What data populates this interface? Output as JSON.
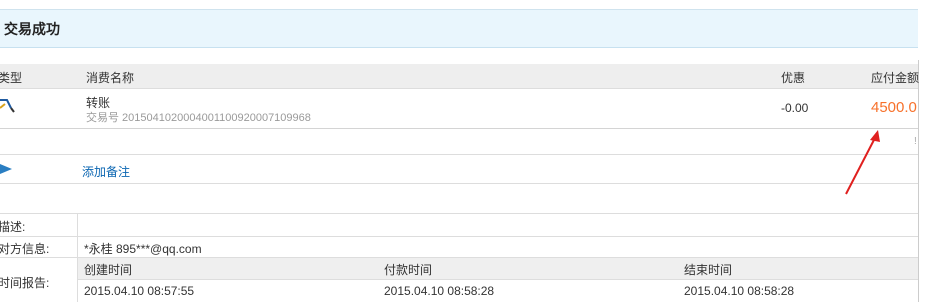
{
  "banner": {
    "title": "交易成功"
  },
  "table_header": {
    "type": "类型",
    "name": "消费名称",
    "discount": "优惠",
    "amount": "应付金额"
  },
  "item": {
    "icon": "transfer-icon",
    "name": "转账",
    "trade_no": "交易号 2015041020004001100920007109968",
    "discount": "-0.00",
    "amount": "4500.0"
  },
  "misc": {
    "tiny_mark": "!"
  },
  "note": {
    "icon": "note-icon",
    "add_label": "添加备注"
  },
  "details": {
    "desc_label": "描述:",
    "counterparty_label": "对方信息:",
    "counterparty_value": "*永桂 895***@qq.com",
    "time_label": "时间报告:"
  },
  "times": {
    "headers": [
      "创建时间",
      "付款时间",
      "结束时间"
    ],
    "values": [
      "2015.04.10 08:57:55",
      "2015.04.10 08:58:28",
      "2015.04.10 08:58:28"
    ]
  },
  "colors": {
    "amount": "#f7712b",
    "link": "#0b66b2",
    "banner_bg": "#e9f6fd",
    "arrow": "#e0201f"
  }
}
